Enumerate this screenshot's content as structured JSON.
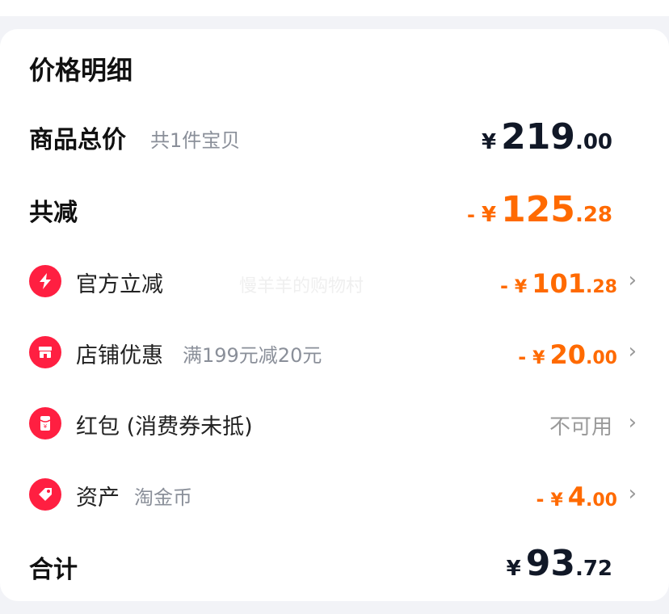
{
  "title": "价格明细",
  "goods": {
    "label": "商品总价",
    "sub": "共1件宝贝",
    "yen": "¥",
    "int": "219",
    "dec": ".00"
  },
  "discount": {
    "label": "共减",
    "sign": "-",
    "yen": "¥",
    "int": "125",
    "dec": ".28"
  },
  "items": [
    {
      "label": "官方立减",
      "sub": "",
      "sign": "-",
      "yen": "¥",
      "int": "101",
      "dec": ".28",
      "icon": "lightning-icon"
    },
    {
      "label": "店铺优惠",
      "sub": "满199元减20元",
      "sign": "-",
      "yen": "¥",
      "int": "20",
      "dec": ".00",
      "icon": "shop-icon"
    },
    {
      "label": "红包 (消费券未抵)",
      "sub": "",
      "status": "不可用",
      "icon": "red-envelope-icon"
    },
    {
      "label": "资产",
      "sub": "淘金币",
      "sign": "-",
      "yen": "¥",
      "int": "4",
      "dec": ".00",
      "icon": "tag-icon"
    }
  ],
  "total": {
    "label": "合计",
    "yen": "¥",
    "int": "93",
    "dec": ".72"
  },
  "watermark": "慢羊羊的购物村",
  "colors": {
    "accent": "#ff6a00",
    "icon_red": "#ff1f41",
    "text_dark": "#111827",
    "muted": "#8a8f99"
  }
}
